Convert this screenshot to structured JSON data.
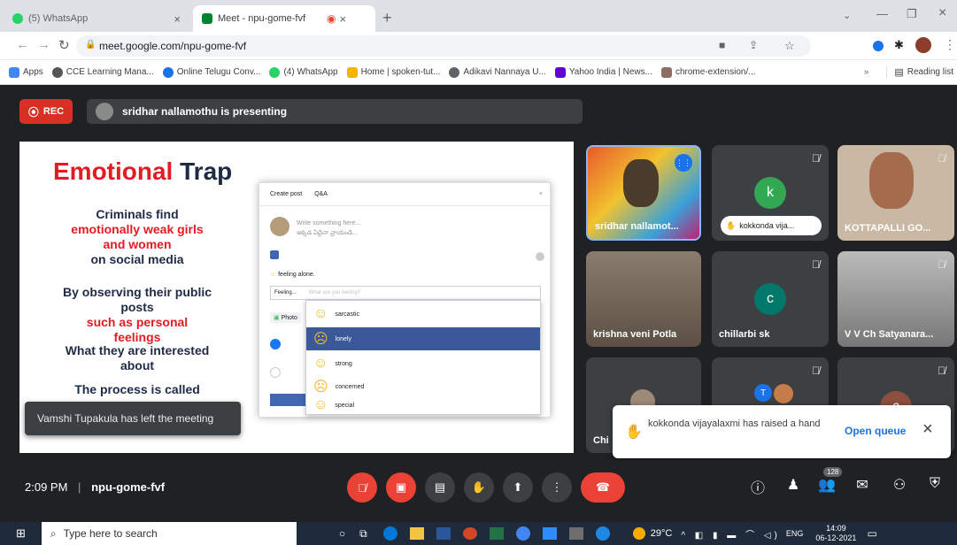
{
  "tabs": [
    {
      "label": "(5) WhatsApp",
      "close": "×"
    },
    {
      "label": "Meet - npu-gome-fvf",
      "close": "×"
    }
  ],
  "new_tab": "+",
  "window_controls": {
    "minimize": "—",
    "restore": "❐",
    "close": "×"
  },
  "address": {
    "url": "meet.google.com/npu-gome-fvf"
  },
  "bookmarks": [
    "Apps",
    "CCE Learning Mana...",
    "Online Telugu Conv...",
    "(4) WhatsApp",
    "Home | spoken-tut...",
    "Adikavi Nannaya U...",
    "Yahoo India | News...",
    "chrome-extension/..."
  ],
  "bookmarks_more": "»",
  "reading_list": "Reading list",
  "meet": {
    "rec_label": "REC",
    "presenting_text": "sridhar nallamothu is presenting",
    "slide": {
      "title_red": "Emotional",
      "title_dark": "Trap",
      "p1_a": "Criminals find",
      "p1_b": "emotionally weak girls and women",
      "p1_c": "on social media",
      "p2_a": "By observing their public posts",
      "p2_b": "such as personal feelings",
      "p3": "What they are interested about",
      "p4": "The process is called",
      "post": {
        "tab_create": "Create post",
        "tab_qa": "Q&A",
        "placeholder1": "Write something here...",
        "placeholder2": "ఇక్కడ ఏదైనా వ్రాయండి...",
        "feeling": "feeling alone.",
        "feeling_input": "Feeling...",
        "feeling_hint": "What are you feeling?",
        "photo": "Photo",
        "options": [
          "sarcastic",
          "lonely",
          "strong",
          "concerned",
          "special"
        ],
        "selected_index": 1
      }
    },
    "toast_left": "Vamshi Tupakula has left the meeting",
    "participants": [
      {
        "name": "sridhar nallamot...",
        "initial": ""
      },
      {
        "name": "kokkonda vija...",
        "initial": "k"
      },
      {
        "name": "KOTTAPALLI GO...",
        "initial": ""
      },
      {
        "name": "krishna veni Potla",
        "initial": ""
      },
      {
        "name": "chillarbi sk",
        "initial": "c"
      },
      {
        "name": "V V Ch Satyanara...",
        "initial": ""
      },
      {
        "name": "Chi",
        "initial": ""
      },
      {
        "name": "",
        "initial": "T"
      },
      {
        "name": "",
        "initial": "c"
      }
    ],
    "hand_raise": {
      "text": "kokkonda vijayalaxmi has raised a hand",
      "button": "Open queue",
      "close": "×"
    },
    "clock": "2:09 PM",
    "meeting_code": "npu-gome-fvf",
    "participant_count": "128",
    "colors": {
      "accent_red": "#ea4335",
      "blue": "#1a73e8",
      "dark": "#202124"
    }
  },
  "taskbar": {
    "search_placeholder": "Type here to search",
    "weather": "29°C",
    "lang": "ENG",
    "time": "14:09",
    "date": "06-12-2021"
  }
}
